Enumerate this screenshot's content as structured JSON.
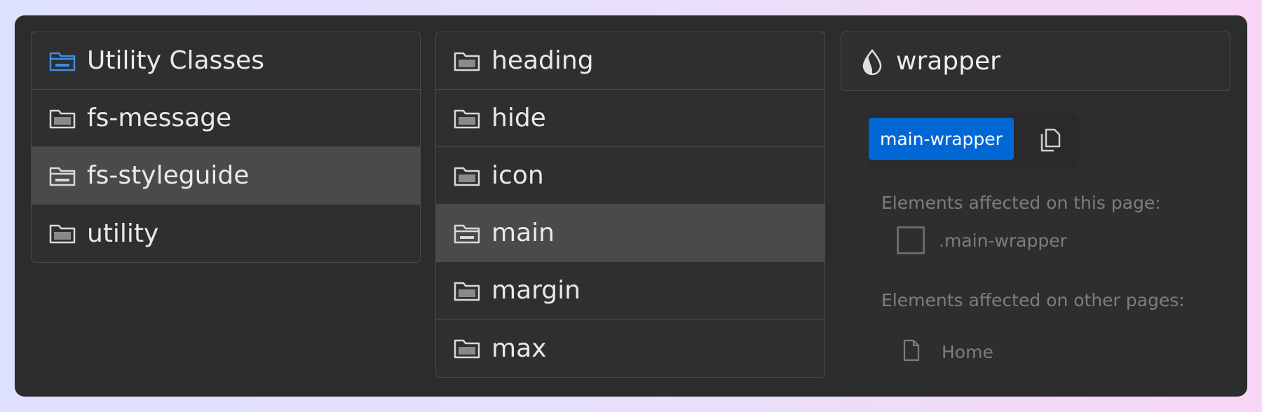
{
  "left_column": {
    "items": [
      {
        "label": "Utility Classes",
        "icon": "folder-open-icon",
        "selected": false,
        "accent": "#3d8fe0"
      },
      {
        "label": "fs-message",
        "icon": "folder-icon",
        "selected": false
      },
      {
        "label": "fs-styleguide",
        "icon": "folder-open-icon",
        "selected": true
      },
      {
        "label": "utility",
        "icon": "folder-icon",
        "selected": false
      }
    ]
  },
  "middle_column": {
    "items": [
      {
        "label": "heading",
        "icon": "folder-icon",
        "selected": false
      },
      {
        "label": "hide",
        "icon": "folder-icon",
        "selected": false
      },
      {
        "label": "icon",
        "icon": "folder-icon",
        "selected": false
      },
      {
        "label": "main",
        "icon": "folder-open-icon",
        "selected": true
      },
      {
        "label": "margin",
        "icon": "folder-icon",
        "selected": false
      },
      {
        "label": "max",
        "icon": "folder-icon",
        "selected": false
      }
    ]
  },
  "detail": {
    "title": "wrapper",
    "title_icon": "droplet-icon",
    "class_chip": "main-wrapper",
    "copy_icon": "copy-icon",
    "this_page_label": "Elements affected on this page:",
    "this_page_item": ".main-wrapper",
    "other_pages_label": "Elements affected on other pages:",
    "other_pages_item": "Home",
    "other_pages_icon": "page-icon"
  },
  "colors": {
    "panel": "#2c2c2c",
    "selected_row": "#4a4a4a",
    "chip": "#0067d4",
    "accent_folder": "#3d8fe0"
  }
}
